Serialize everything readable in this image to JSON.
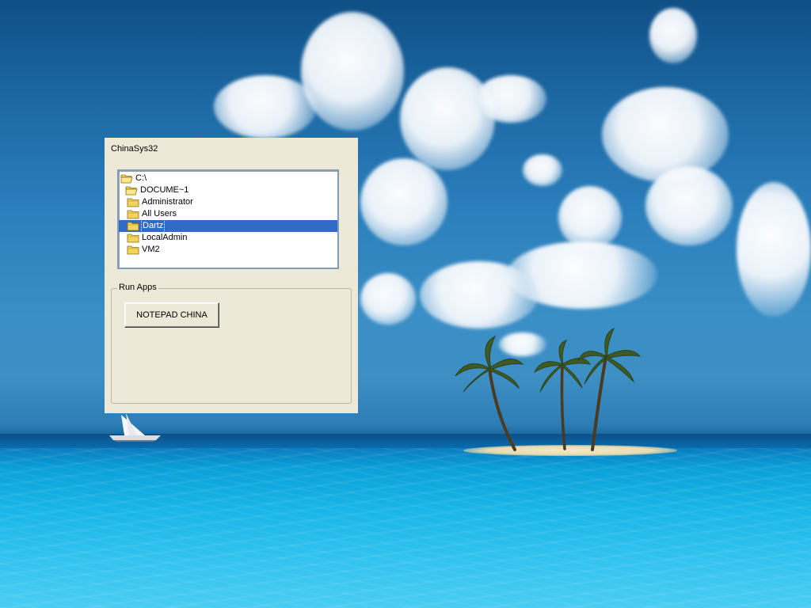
{
  "window": {
    "title": "ChinaSys32"
  },
  "tree": {
    "items": [
      {
        "label": "C:\\",
        "icon": "open-folder-icon",
        "indent": 0,
        "selected": false
      },
      {
        "label": "DOCUME~1",
        "icon": "open-folder-icon",
        "indent": 1,
        "selected": false
      },
      {
        "label": "Administrator",
        "icon": "folder-icon",
        "indent": 2,
        "selected": false
      },
      {
        "label": "All Users",
        "icon": "folder-icon",
        "indent": 2,
        "selected": false
      },
      {
        "label": "Dartz",
        "icon": "folder-icon",
        "indent": 2,
        "selected": true
      },
      {
        "label": "LocalAdmin",
        "icon": "folder-icon",
        "indent": 2,
        "selected": false
      },
      {
        "label": "VM2",
        "icon": "folder-icon",
        "indent": 2,
        "selected": false
      }
    ]
  },
  "run_apps": {
    "group_label": "Run Apps",
    "notepad_button_label": "NOTEPAD CHINA"
  },
  "colors": {
    "window_bg": "#ece9d8",
    "selection_bg": "#316ac5",
    "folder_yellow": "#f2d55a"
  }
}
